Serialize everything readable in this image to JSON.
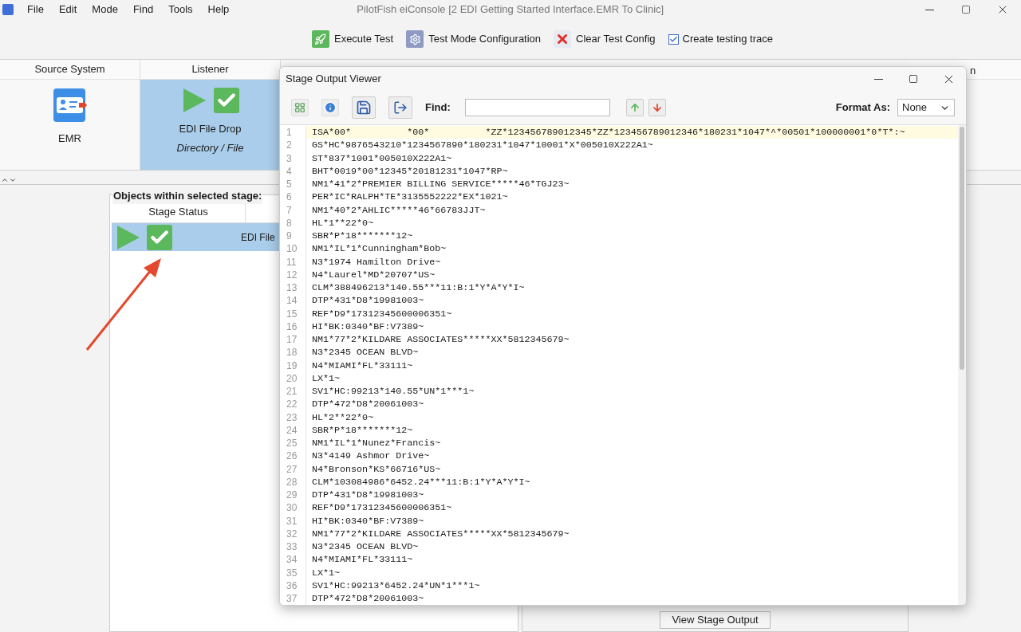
{
  "window": {
    "title": "PilotFish eiConsole [2 EDI Getting Started Interface.EMR To Clinic]"
  },
  "menu": [
    "File",
    "Edit",
    "Mode",
    "Find",
    "Tools",
    "Help"
  ],
  "toolbar": {
    "buttons": [
      {
        "label": "Execute Test",
        "kind": "execute"
      },
      {
        "label": "Test Mode Configuration",
        "kind": "config"
      },
      {
        "label": "Clear Test Config",
        "kind": "clear"
      }
    ],
    "trace": {
      "label": "Create testing trace",
      "checked": true
    }
  },
  "stages": [
    {
      "header": "Source System",
      "kind": "source",
      "name": "EMR",
      "selected": false
    },
    {
      "header": "Listener",
      "kind": "listener",
      "name": "EDI File Drop",
      "subtitle": "Directory / File",
      "selected": true
    }
  ],
  "stage_header_fragment": "n",
  "objects_panel": {
    "title": "Objects within selected stage:",
    "columns": [
      "Stage Status"
    ],
    "rows": [
      {
        "cell": "EDI File",
        "selected": true
      }
    ]
  },
  "view_button": "View Stage Output",
  "viewer": {
    "title": "Stage Output Viewer",
    "find_label": "Find:",
    "format_label": "Format As:",
    "format_value": "None",
    "lines": [
      {
        "number": "1",
        "text": "ISA*00*          *00*          *ZZ*123456789012345*ZZ*123456789012346*180231*1047*^*00501*100000001*0*T*:~",
        "highlighted": true
      },
      {
        "number": "2",
        "text": "GS*HC*9876543210*1234567890*180231*1047*10001*X*005010X222A1~",
        "highlighted": false
      },
      {
        "number": "3",
        "text": "ST*837*1001*005010X222A1~",
        "highlighted": false
      },
      {
        "number": "4",
        "text": "BHT*0019*00*12345*20181231*1047*RP~",
        "highlighted": false
      },
      {
        "number": "5",
        "text": "NM1*41*2*PREMIER BILLING SERVICE*****46*TGJ23~",
        "highlighted": false
      },
      {
        "number": "6",
        "text": "PER*IC*RALPH*TE*3135552222*EX*1021~",
        "highlighted": false
      },
      {
        "number": "7",
        "text": "NM1*40*2*AHLIC*****46*66783JJT~",
        "highlighted": false
      },
      {
        "number": "8",
        "text": "HL*1**22*0~",
        "highlighted": false
      },
      {
        "number": "9",
        "text": "SBR*P*18*******12~",
        "highlighted": false
      },
      {
        "number": "10",
        "text": "NM1*IL*1*Cunningham*Bob~",
        "highlighted": false
      },
      {
        "number": "11",
        "text": "N3*1974 Hamilton Drive~",
        "highlighted": false
      },
      {
        "number": "12",
        "text": "N4*Laurel*MD*20707*US~",
        "highlighted": false
      },
      {
        "number": "13",
        "text": "CLM*388496213*140.55***11:B:1*Y*A*Y*I~",
        "highlighted": false
      },
      {
        "number": "14",
        "text": "DTP*431*D8*19981003~",
        "highlighted": false
      },
      {
        "number": "15",
        "text": "REF*D9*17312345600006351~",
        "highlighted": false
      },
      {
        "number": "16",
        "text": "HI*BK:0340*BF:V7389~",
        "highlighted": false
      },
      {
        "number": "17",
        "text": "NM1*77*2*KILDARE ASSOCIATES*****XX*5812345679~",
        "highlighted": false
      },
      {
        "number": "18",
        "text": "N3*2345 OCEAN BLVD~",
        "highlighted": false
      },
      {
        "number": "19",
        "text": "N4*MIAMI*FL*33111~",
        "highlighted": false
      },
      {
        "number": "20",
        "text": "LX*1~",
        "highlighted": false
      },
      {
        "number": "21",
        "text": "SV1*HC:99213*140.55*UN*1***1~",
        "highlighted": false
      },
      {
        "number": "22",
        "text": "DTP*472*D8*20061003~",
        "highlighted": false
      },
      {
        "number": "23",
        "text": "HL*2**22*0~",
        "highlighted": false
      },
      {
        "number": "24",
        "text": "SBR*P*18*******12~",
        "highlighted": false
      },
      {
        "number": "25",
        "text": "NM1*IL*1*Nunez*Francis~",
        "highlighted": false
      },
      {
        "number": "26",
        "text": "N3*4149 Ashmor Drive~",
        "highlighted": false
      },
      {
        "number": "27",
        "text": "N4*Bronson*KS*66716*US~",
        "highlighted": false
      },
      {
        "number": "28",
        "text": "CLM*103084986*6452.24***11:B:1*Y*A*Y*I~",
        "highlighted": false
      },
      {
        "number": "29",
        "text": "DTP*431*D8*19981003~",
        "highlighted": false
      },
      {
        "number": "30",
        "text": "REF*D9*17312345600006351~",
        "highlighted": false
      },
      {
        "number": "31",
        "text": "HI*BK:0340*BF:V7389~",
        "highlighted": false
      },
      {
        "number": "32",
        "text": "NM1*77*2*KILDARE ASSOCIATES*****XX*5812345679~",
        "highlighted": false
      },
      {
        "number": "33",
        "text": "N3*2345 OCEAN BLVD~",
        "highlighted": false
      },
      {
        "number": "34",
        "text": "N4*MIAMI*FL*33111~",
        "highlighted": false
      },
      {
        "number": "35",
        "text": "LX*1~",
        "highlighted": false
      },
      {
        "number": "36",
        "text": "SV1*HC:99213*6452.24*UN*1***1~",
        "highlighted": false
      },
      {
        "number": "37",
        "text": "DTP*472*D8*20061003~",
        "highlighted": false
      }
    ]
  }
}
